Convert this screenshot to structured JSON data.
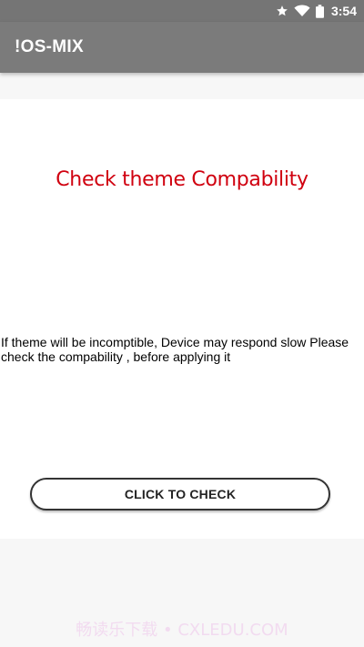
{
  "status_bar": {
    "time": "3:54",
    "icons": [
      "star-icon",
      "wifi-icon",
      "battery-icon"
    ]
  },
  "app_bar": {
    "title": "!OS-MIX"
  },
  "content": {
    "heading": "Check theme Compability",
    "description": "If theme will be incomptible, Device may respond slow Please check the compability , before applying it",
    "button_label": "CLICK TO CHECK"
  },
  "watermark": "畅读乐下载 • CXLEDU.COM",
  "colors": {
    "app_bar": "#7b7b7b",
    "status_bar": "#757575",
    "heading": "#d0000f",
    "background": "#f7f7f7",
    "card": "#ffffff"
  }
}
